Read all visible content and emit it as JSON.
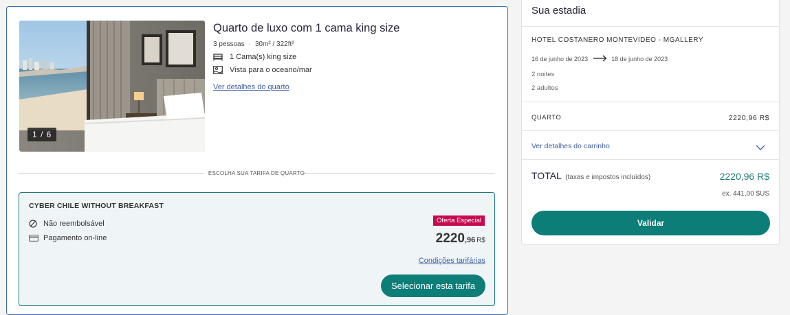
{
  "room": {
    "title": "Quarto de luxo com 1 cama king size",
    "capacity": "3 pessoas",
    "size": "30m² / 322ft²",
    "features": [
      {
        "icon": "bed-icon",
        "label": "1 Cama(s) king size"
      },
      {
        "icon": "sea-view-icon",
        "label": "Vista para o oceano/mar"
      }
    ],
    "details_link": "Ver detalhes do quarto",
    "photo_counter": "1 / 6"
  },
  "rate_section": {
    "divider_label": "ESCOLHA SUA TARIFA DE QUARTO"
  },
  "rate": {
    "name": "CYBER CHILE WITHOUT BREAKFAST",
    "conditions": [
      {
        "icon": "non-refundable-icon",
        "label": "Não reembolsável"
      },
      {
        "icon": "credit-card-icon",
        "label": "Pagamento on-line"
      }
    ],
    "badge": "Oferta Especial",
    "price_int": "2220",
    "price_dec": ",96",
    "price_currency": "R$",
    "conditions_link": "Condições tarifárias",
    "select_label": "Selecionar esta tarifa"
  },
  "summary": {
    "title": "Sua estadia",
    "hotel": "HOTEL COSTANERO MONTEVIDEO - MGALLERY",
    "checkin": "16 de junho de 2023",
    "checkout": "18 de junho de 2023",
    "nights": "2 noites",
    "guests": "2 adultos",
    "room_label": "QUARTO",
    "room_price": "2220,96 R$",
    "cart_link": "Ver detalhes do carrinho",
    "total_label": "TOTAL",
    "total_note": "(taxas e impostos incluídos)",
    "total_value": "2220,96 R$",
    "usd_value": "ex. 441,00 $US",
    "validate_label": "Validar"
  },
  "colors": {
    "accent": "#0d7d78",
    "link": "#3f5f9e",
    "badge": "#c8094f",
    "card_border": "#3a6fb3"
  }
}
